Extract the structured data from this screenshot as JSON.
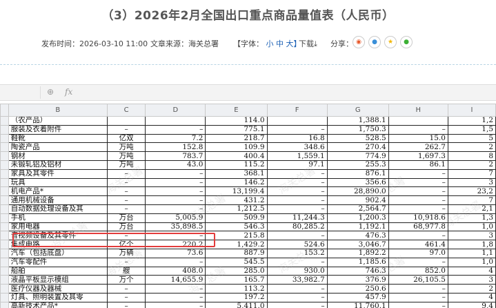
{
  "title": "（3）2026年2月全国出口重点商品量值表（人民币）",
  "meta": {
    "publish": "发布时间：2026-03-10 11:00",
    "source": "文章来源：海关总署",
    "font_label": "【字体：",
    "font_small": "小",
    "font_mid": "中",
    "font_large": "大】",
    "download": "下载⤓",
    "share": "分享："
  },
  "share_icons": [
    "weibo-icon",
    "qzone-icon",
    "star-icon",
    "wechat-icon"
  ],
  "formula_bar": {
    "zoom": "⊕",
    "fx": "fx"
  },
  "columns": [
    "",
    "B",
    "C",
    "D",
    "E",
    "F",
    "G",
    "H",
    "I"
  ],
  "rows": [
    {
      "b": "（农产品）",
      "c": "",
      "d": "",
      "e": "114.0",
      "f": "",
      "g": "1,388.1",
      "h": "",
      "i": "1,2"
    },
    {
      "b": "服装及衣着附件",
      "c": "–",
      "d": "–",
      "e": "775.1",
      "f": "–",
      "g": "1,750.3",
      "h": "–",
      "i": "1,5"
    },
    {
      "b": "鞋靴",
      "c": "亿双",
      "d": "7.2",
      "e": "218.7",
      "f": "16.8",
      "g": "528.5",
      "h": "15.0",
      "i": "5"
    },
    {
      "b": "陶瓷产品",
      "c": "万吨",
      "d": "152.8",
      "e": "109.9",
      "f": "348.6",
      "g": "270.4",
      "h": "262.7",
      "i": "2"
    },
    {
      "b": "钢材",
      "c": "万吨",
      "d": "783.7",
      "e": "400.4",
      "f": "1,559.1",
      "g": "774.9",
      "h": "1,697.3",
      "i": "8"
    },
    {
      "b": "未锻轧铝及铝材",
      "c": "万吨",
      "d": "43.0",
      "e": "115.2",
      "f": "97.1",
      "g": "255.3",
      "h": "86.1",
      "i": "2"
    },
    {
      "b": "家具及其零件",
      "c": "–",
      "d": "–",
      "e": "368.1",
      "f": "–",
      "g": "876.1",
      "h": "–",
      "i": "7"
    },
    {
      "b": "玩具",
      "c": "–",
      "d": "–",
      "e": "146.2",
      "f": "–",
      "g": "356.6",
      "h": "–",
      "i": "3"
    },
    {
      "b": "机电产品*",
      "c": "–",
      "d": "–",
      "e": "13,199.4",
      "f": "–",
      "g": "28,890.0",
      "h": "–",
      "i": "23,2"
    },
    {
      "b": "  通用机械设备",
      "c": "–",
      "d": "–",
      "e": "431.2",
      "f": "–",
      "g": "902.4",
      "h": "–",
      "i": "7"
    },
    {
      "b": "  自动数据处理设备及其",
      "c": "–",
      "d": "–",
      "e": "1,212.5",
      "f": "–",
      "g": "2,564.7",
      "h": "–",
      "i": "2,1"
    },
    {
      "b": "  手机",
      "c": "万台",
      "d": "5,005.9",
      "e": "509.9",
      "f": "11,244.3",
      "g": "1,200.3",
      "h": "10,918.6",
      "i": "1,3"
    },
    {
      "b": "  家用电器",
      "c": "万台",
      "d": "35,898.5",
      "e": "546.3",
      "f": "80,285.2",
      "g": "1,192.1",
      "h": "68,977.8",
      "i": "1,0"
    },
    {
      "b": "  音视频设备及其零件",
      "c": "–",
      "d": "–",
      "e": "215.8",
      "f": "–",
      "g": "476.3",
      "h": "–",
      "i": "3"
    },
    {
      "b": "  集成电路",
      "c": "亿个",
      "d": "220.2",
      "e": "1,429.2",
      "f": "524.6",
      "g": "3,046.7",
      "h": "461.4",
      "i": "1,8"
    },
    {
      "b": "  汽车（包括底盘）",
      "c": "万辆",
      "d": "73.6",
      "e": "887.9",
      "f": "153.2",
      "g": "1,892.2",
      "h": "97.0",
      "i": "1,1"
    },
    {
      "b": "  汽车零配件",
      "c": "–",
      "d": "–",
      "e": "545.5",
      "f": "–",
      "g": "1,185.6",
      "h": "–",
      "i": "1,0"
    },
    {
      "b": "  船舶",
      "c": "艘",
      "d": "408.0",
      "e": "285.0",
      "f": "930.0",
      "g": "746.3",
      "h": "852.0",
      "i": "4"
    },
    {
      "b": "  液晶平板显示模组",
      "c": "万个",
      "d": "14,655.9",
      "e": "165.7",
      "f": "33,982.7",
      "g": "376.9",
      "h": "26,105.5",
      "i": "3"
    },
    {
      "b": "  医疗仪器及器械",
      "c": "–",
      "d": "–",
      "e": "113.2",
      "f": "–",
      "g": "250.6",
      "h": "–",
      "i": "2"
    },
    {
      "b": "  灯具、照明装置及其零",
      "c": "–",
      "d": "–",
      "e": "197.2",
      "f": "–",
      "g": "457.9",
      "h": "–",
      "i": "4"
    },
    {
      "b": "高新技术产品*",
      "c": "–",
      "d": "–",
      "e": "5,411.0",
      "f": "–",
      "g": "11,760.1",
      "h": "–",
      "i": "9,4"
    }
  ],
  "watermark": "海关总署"
}
